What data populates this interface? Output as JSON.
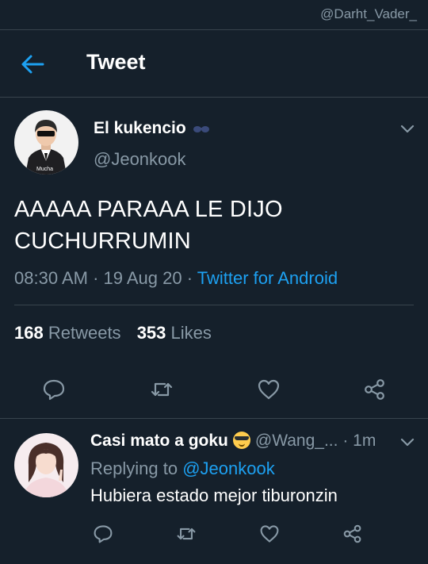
{
  "watermark": "@Darht_Vader_",
  "header": {
    "title": "Tweet"
  },
  "tweet": {
    "author_name": "El kukencio",
    "author_handle": "@Jeonkook",
    "avatar_caption": "Mucha",
    "text_line1": "AAAAA PARAAA LE DIJO",
    "text_line2": "CUCHURRUMIN",
    "time": "08:30 AM",
    "date": "19 Aug 20",
    "separator": " · ",
    "source": "Twitter for Android",
    "retweets_count": "168",
    "retweets_label": "Retweets",
    "likes_count": "353",
    "likes_label": "Likes",
    "actions": [
      "reply-icon",
      "retweet-icon",
      "like-icon",
      "share-icon"
    ]
  },
  "reply": {
    "author_name": "Casi mato a goku",
    "author_handle": "@Wang_...",
    "time_ago": "· 1m",
    "replying_prefix": "Replying to ",
    "replying_to": "@Jeonkook",
    "text": "Hubiera estado mejor tiburonzin",
    "actions": [
      "reply-icon",
      "retweet-icon",
      "like-icon",
      "share-icon"
    ]
  },
  "colors": {
    "background": "#15202b",
    "divider": "#38444d",
    "secondary_text": "#8899a6",
    "accent": "#1da1f2"
  }
}
